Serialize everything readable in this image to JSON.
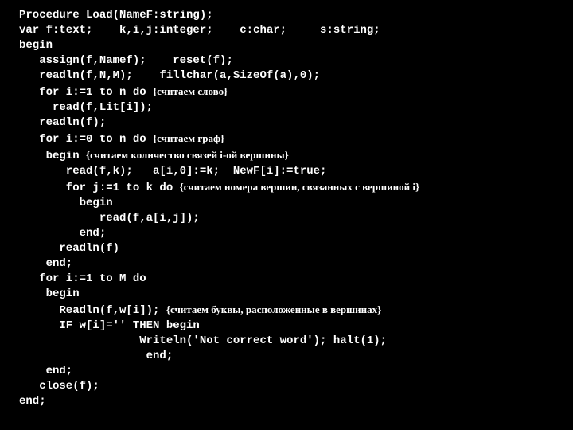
{
  "lines": [
    {
      "code": "Procedure Load(NameF:string);"
    },
    {
      "code": "var f:text;    k,i,j:integer;    c:char;     s:string;"
    },
    {
      "code": "begin"
    },
    {
      "code": "   assign(f,Namef);    reset(f);"
    },
    {
      "code": "   readln(f,N,M);    fillchar(a,SizeOf(a),0);"
    },
    {
      "code": "   for i:=1 to n do ",
      "comment": "{считаем слово}"
    },
    {
      "code": "     read(f,Lit[i]);"
    },
    {
      "code": "   readln(f);"
    },
    {
      "code": "   for i:=0 to n do ",
      "comment": "{считаем граф}"
    },
    {
      "code": "    begin ",
      "comment": "{считаем количество связей i-ой вершины}"
    },
    {
      "code": "       read(f,k);   a[i,0]:=k;  NewF[i]:=true;"
    },
    {
      "code": "       for j:=1 to k do ",
      "comment": "{считаем номера вершин, связанных с вершиной i}"
    },
    {
      "code": "         begin"
    },
    {
      "code": "            read(f,a[i,j]);"
    },
    {
      "code": "         end;"
    },
    {
      "code": "      readln(f)"
    },
    {
      "code": "    end;"
    },
    {
      "code": "   for i:=1 to M do"
    },
    {
      "code": "    begin"
    },
    {
      "code": "      Readln(f,w[i]); ",
      "comment": "{считаем буквы, расположенные в вершинах}"
    },
    {
      "code": "      IF w[i]='' THEN begin"
    },
    {
      "code": "                  Writeln('Not correct word'); halt(1);"
    },
    {
      "code": "                   end;"
    },
    {
      "code": "    end;"
    },
    {
      "code": "   close(f);"
    },
    {
      "code": "end;"
    }
  ]
}
